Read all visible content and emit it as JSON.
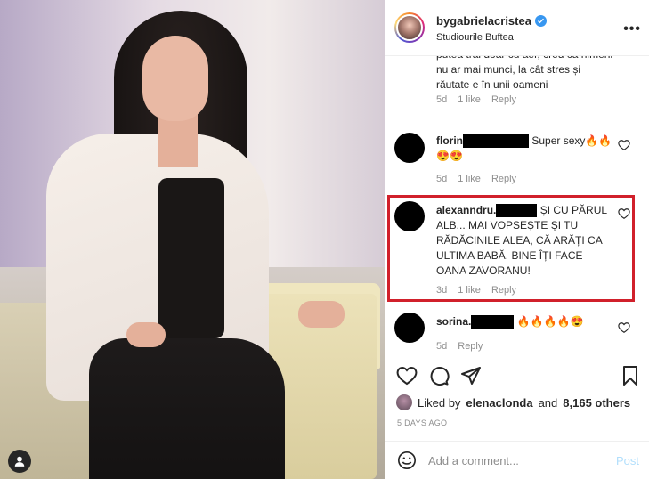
{
  "post": {
    "username": "bygabrielacristea",
    "location": "Studiourile Buftea",
    "more_label": "•••"
  },
  "comments": [
    {
      "text": "putea trăi doar cu aer, cred că nimeni nu ar mai munci, la cât stres și răutate e în unii oameni",
      "age": "5d",
      "likes": "1 like",
      "reply": "Reply"
    },
    {
      "user": "florin",
      "text": "Super sexy",
      "emojis": "🔥🔥😍😍",
      "age": "5d",
      "likes": "1 like",
      "reply": "Reply"
    },
    {
      "user": "alexanndru.",
      "text": "ȘI CU PĂRUL ALB... MAI VOPSEȘTE ȘI TU RĂDĂCINILE ALEA, CĂ ARĂȚI CA ULTIMA BABĂ. BINE ÎȚI FACE OANA ZAVORANU!",
      "age": "3d",
      "likes": "1 like",
      "reply": "Reply",
      "highlighted": true
    },
    {
      "user": "sorina.",
      "emojis": "🔥🔥🔥🔥😍",
      "age": "5d",
      "reply": "Reply"
    }
  ],
  "likes": {
    "prefix": "Liked by",
    "user": "elenaclonda",
    "joiner": "and",
    "others": "8,165 others"
  },
  "date": "5 DAYS AGO",
  "add_comment": {
    "placeholder": "Add a comment...",
    "post_label": "Post"
  },
  "colors": {
    "highlight_border": "#d1202b",
    "verified_blue": "#3897f0",
    "post_disabled": "#b2dffc",
    "muted_text": "#8e8e8e"
  },
  "icons": [
    "heart-icon",
    "comment-icon",
    "share-icon",
    "bookmark-icon",
    "emoji-icon",
    "user-tag-icon",
    "verified-icon"
  ]
}
